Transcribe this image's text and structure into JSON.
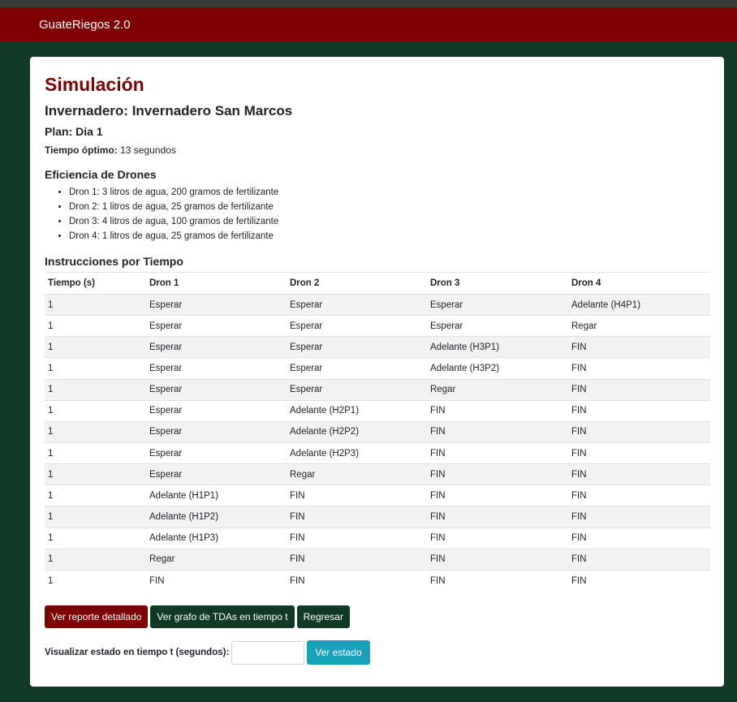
{
  "navbar": {
    "brand": "GuateRiegos 2.0"
  },
  "page": {
    "title": "Simulación",
    "invernadero": "Invernadero: Invernadero San Marcos",
    "plan": "Plan: Dia 1",
    "tiempo_optimo_label": "Tiempo óptimo:",
    "tiempo_optimo_value": "13 segundos"
  },
  "eficiencia": {
    "heading": "Eficiencia de Drones",
    "items": [
      "Dron 1: 3 litros de agua, 200 gramos de fertilizante",
      "Dron 2: 1 litros de agua, 25 gramos de fertilizante",
      "Dron 3: 4 litros de agua, 100 gramos de fertilizante",
      "Dron 4: 1 litros de agua, 25 gramos de fertilizante"
    ]
  },
  "instrucciones": {
    "heading": "Instrucciones por Tiempo",
    "columns": [
      "Tiempo (s)",
      "Dron 1",
      "Dron 2",
      "Dron 3",
      "Dron 4"
    ],
    "rows": [
      [
        "1",
        "Esperar",
        "Esperar",
        "Esperar",
        "Adelante (H4P1)"
      ],
      [
        "1",
        "Esperar",
        "Esperar",
        "Esperar",
        "Regar"
      ],
      [
        "1",
        "Esperar",
        "Esperar",
        "Adelante (H3P1)",
        "FIN"
      ],
      [
        "1",
        "Esperar",
        "Esperar",
        "Adelante (H3P2)",
        "FIN"
      ],
      [
        "1",
        "Esperar",
        "Esperar",
        "Regar",
        "FIN"
      ],
      [
        "1",
        "Esperar",
        "Adelante (H2P1)",
        "FIN",
        "FIN"
      ],
      [
        "1",
        "Esperar",
        "Adelante (H2P2)",
        "FIN",
        "FIN"
      ],
      [
        "1",
        "Esperar",
        "Adelante (H2P3)",
        "FIN",
        "FIN"
      ],
      [
        "1",
        "Esperar",
        "Regar",
        "FIN",
        "FIN"
      ],
      [
        "1",
        "Adelante (H1P1)",
        "FIN",
        "FIN",
        "FIN"
      ],
      [
        "1",
        "Adelante (H1P2)",
        "FIN",
        "FIN",
        "FIN"
      ],
      [
        "1",
        "Adelante (H1P3)",
        "FIN",
        "FIN",
        "FIN"
      ],
      [
        "1",
        "Regar",
        "FIN",
        "FIN",
        "FIN"
      ],
      [
        "1",
        "FIN",
        "FIN",
        "FIN",
        "FIN"
      ]
    ]
  },
  "actions": {
    "reporte": "Ver reporte detallado",
    "grafo": "Ver grafo de TDAs en tiempo t",
    "regresar": "Regresar"
  },
  "estado": {
    "label": "Visualizar estado en tiempo t (segundos):",
    "input_value": "",
    "button": "Ver estado"
  },
  "colors": {
    "navbar": "#7f0000",
    "background": "#0f3a26",
    "title": "#7f0000",
    "button_teal": "#17a2b8"
  }
}
